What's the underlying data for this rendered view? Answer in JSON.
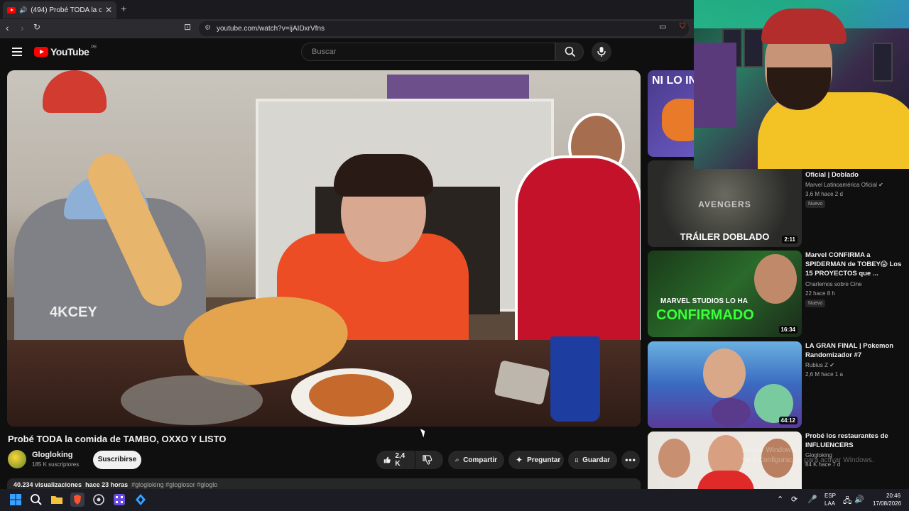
{
  "browser": {
    "tab_title": "(494) Probé TODA la comida d",
    "new_tab": "+",
    "url": "youtube.com/watch?v=ijAIDxrVfns"
  },
  "youtube": {
    "logo_text": "YouTube",
    "country": "PE",
    "search_placeholder": "Buscar"
  },
  "video": {
    "title": "Probé TODA la comida de TAMBO, OXXO Y LISTO",
    "channel": "Glogloking",
    "subscribers": "185 K suscriptores",
    "subscribe_label": "Suscribirse",
    "likes": "2,4 K",
    "share_label": "Compartir",
    "ask_label": "Preguntar",
    "save_label": "Guardar",
    "views": "40.234 visualizaciones",
    "date": "hace 23 horas",
    "hashtags": "#glogloking #gloglosor #gloglo"
  },
  "video_frame_text": {
    "shirt_text": "4KCEY"
  },
  "sidebar": [
    {
      "thumb_text": "NI LO IN",
      "title": "",
      "channel": "",
      "meta": "",
      "duration": ""
    },
    {
      "thumb_text": "TRÁILER DOBLADO",
      "thumb_logo": "AVENGERS",
      "title": "Oficial | Doblado",
      "channel": "Marvel Latinoamérica Oficial",
      "meta": "3,6 M  hace 2 d",
      "badge": "Nuevo",
      "duration": "2:11"
    },
    {
      "thumb_text": "MARVEL STUDIOS LO HA",
      "thumb_text2": "CONFIRMADO",
      "title": "Marvel CONFIRMA a SPIDERMAN de TOBEY😱 Los 15 PROYECTOS que ...",
      "channel": "Charlemos sobre Cine",
      "meta": "22  hace 8 h",
      "badge": "Nuevo",
      "duration": "16:34"
    },
    {
      "title": "LA GRAN FINAL | Pokemon Randomizador #7",
      "channel": "Rubius Z",
      "meta": "2,6 M  hace 1 a",
      "duration": "44:12"
    },
    {
      "title": "Probé los restaurantes de INFLUENCERS",
      "channel": "Glogloking",
      "meta": "84 K  hace 7 d"
    }
  ],
  "watermark": {
    "line1": "Activar Windows",
    "line2": "Ve a Configuración para activar Windows."
  },
  "taskbar": {
    "lang1": "ESP",
    "lang2": "LAA",
    "time": "20:46",
    "date": "17/08/2026"
  },
  "colors": {
    "yt_red": "#ff0000",
    "bg": "#0f0f0f",
    "pill": "#272727"
  }
}
